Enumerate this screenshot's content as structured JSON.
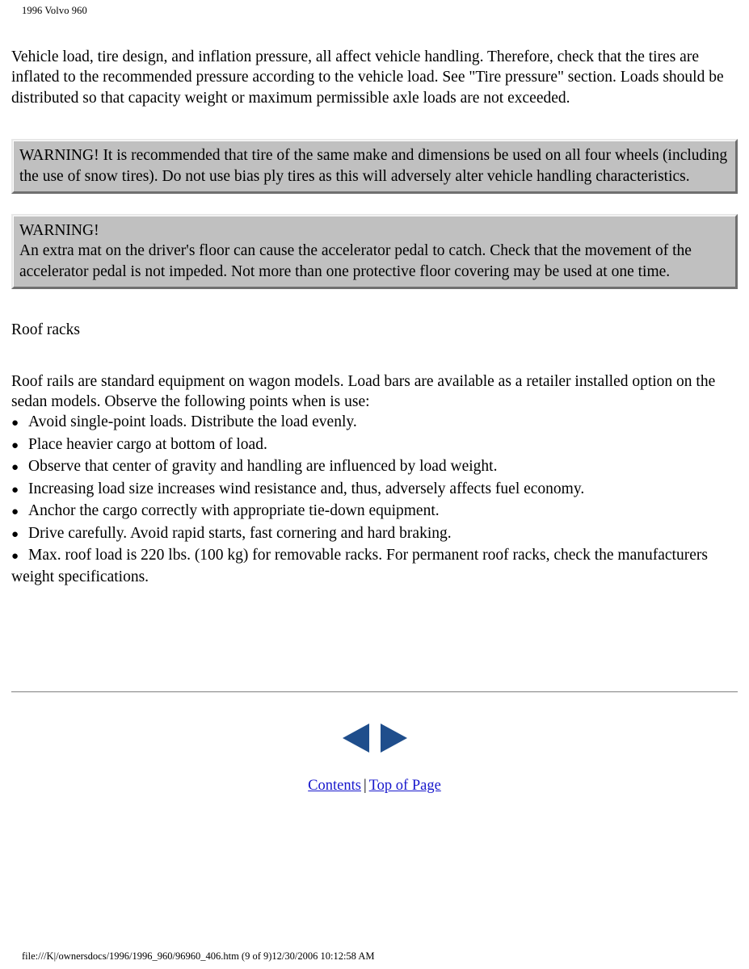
{
  "document": {
    "running_header": "1996 Volvo 960",
    "file_footer": "file:///K|/ownersdocs/1996/1996_960/96960_406.htm (9 of 9)12/30/2006 10:12:58 AM"
  },
  "intro": {
    "paragraph": "Vehicle load, tire design, and inflation pressure, all affect vehicle handling. Therefore, check that the tires are inflated to the recommended pressure according to the vehicle load. See \"Tire pressure\" section. Loads should be distributed so that capacity weight or maximum permissible axle loads are not exceeded."
  },
  "warnings": [
    {
      "title": "",
      "text": "WARNING! It is recommended that tire of the same make and dimensions be used on all four wheels (including the use of snow tires). Do not use bias ply tires as this will adversely alter vehicle handling characteristics."
    },
    {
      "title": "WARNING!",
      "text": "An extra mat on the driver's floor can cause the accelerator pedal to catch. Check that the movement of the accelerator pedal is not impeded. Not more than one protective floor covering may be used at one time."
    }
  ],
  "roof_racks": {
    "heading": "Roof racks",
    "intro": "Roof rails are standard equipment on wagon models. Load bars are available as a retailer installed option on the sedan models. Observe the following points when is use:",
    "bullet_char": "●",
    "bullets": [
      "Avoid single-point loads. Distribute the load evenly.",
      "Place heavier cargo at bottom of load.",
      "Observe that center of gravity and handling are influenced by load weight.",
      "Increasing load size increases wind resistance and, thus, adversely affects fuel economy.",
      "Anchor the cargo correctly with appropriate tie-down equipment.",
      "Drive carefully. Avoid rapid starts, fast cornering and hard braking.",
      "Max. roof load is 220 lbs. (100 kg) for removable racks. For permanent roof racks, check the manufacturers weight specifications."
    ]
  },
  "navigation": {
    "prev_label": "Previous page",
    "next_label": "Next page",
    "arrow_color": "#1f4e8c",
    "contents_label": "Contents",
    "separator": "|",
    "top_of_page_label": "Top of Page",
    "link_color": "#1717cc"
  }
}
